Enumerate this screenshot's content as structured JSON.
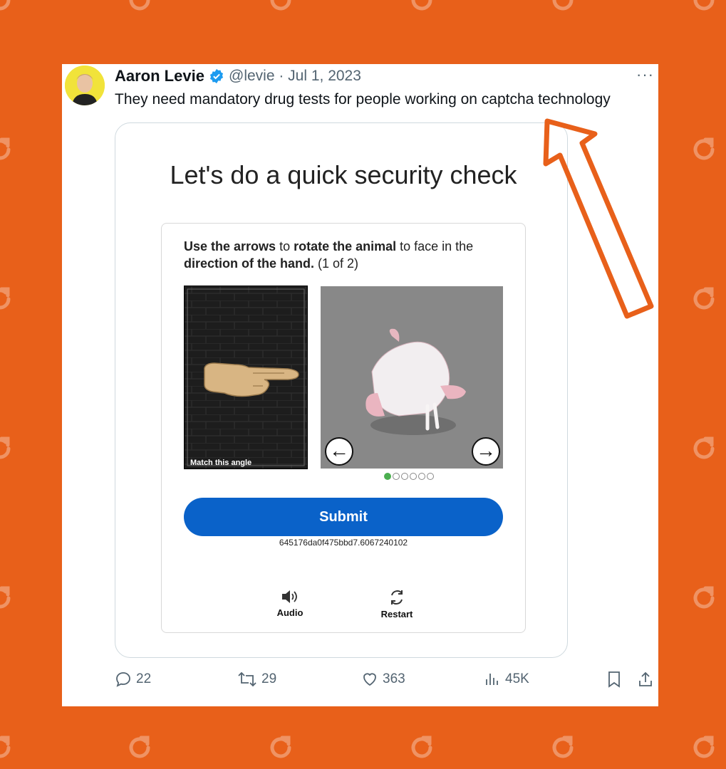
{
  "tweet": {
    "author_name": "Aaron Levie",
    "handle_date": "@levie · Jul 1, 2023",
    "more_label": "···",
    "text": "They need mandatory drug tests for people working on captcha technology"
  },
  "captcha": {
    "title": "Let's do a quick security check",
    "instruction": {
      "part1_bold": "Use the arrows",
      "part2": " to ",
      "part3_bold": "rotate the animal",
      "part4": " to face in the ",
      "part5_bold": "direction of the hand.",
      "part6": " (1 of 2)"
    },
    "hand_caption": "Match this angle",
    "left_arrow": "←",
    "right_arrow": "→",
    "progress": {
      "current": 1,
      "total": 6
    },
    "submit_label": "Submit",
    "token": "645176da0f475bbd7.6067240102",
    "audio_label": "Audio",
    "restart_label": "Restart"
  },
  "actions": {
    "replies": "22",
    "retweets": "29",
    "likes": "363",
    "views": "45K"
  },
  "colors": {
    "background": "#e8601a",
    "submit": "#0a62c9",
    "verified": "#1d9bf0",
    "callout_arrow": "#e8601a"
  }
}
